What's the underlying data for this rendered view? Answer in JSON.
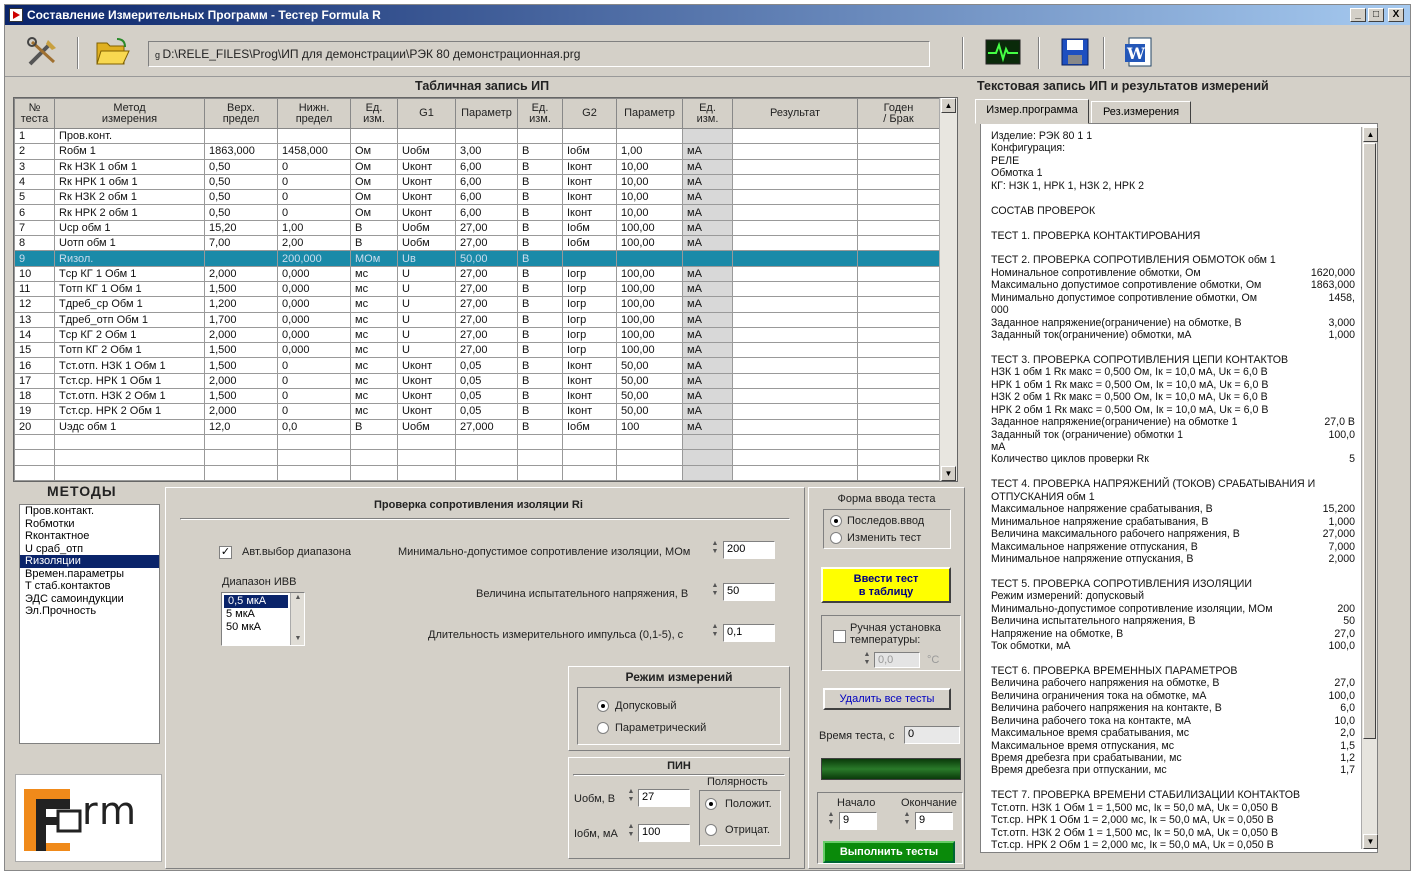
{
  "window": {
    "title": "Составление Измерительных Программ - Тестер Formula R",
    "controls": [
      "_",
      "□",
      "X"
    ]
  },
  "toolbar": {
    "path": "D:\\RELE_FILES\\Prog\\ИП для демонстрации\\РЭК 80 демонстрационная.prg",
    "icons": [
      "tools-icon",
      "folder-open-icon",
      "signal-icon",
      "floppy-save-icon",
      "word-doc-icon"
    ]
  },
  "table_section": {
    "title": "Табличная запись ИП",
    "headers": [
      "№\nтеста",
      "Метод\nизмерения",
      "Верх.\nпредел",
      "Нижн.\nпредел",
      "Ед.\nизм.",
      "G1",
      "Параметр",
      "Ед.\nизм.",
      "G2",
      "Параметр",
      "Ед.\nизм.",
      "Результат",
      "Годен\n/ Брак"
    ],
    "rows": [
      [
        "1",
        "Пров.конт.",
        "",
        "",
        "",
        "",
        "",
        "",
        "",
        "",
        "",
        "",
        ""
      ],
      [
        "2",
        "Rобм 1",
        "1863,000",
        "1458,000",
        "Ом",
        "Uобм",
        "3,00",
        "В",
        "Iобм",
        "1,00",
        "мА",
        "",
        ""
      ],
      [
        "3",
        "Rк НЗК 1 обм 1",
        "0,50",
        "0",
        "Ом",
        "Uконт",
        "6,00",
        "В",
        "Iконт",
        "10,00",
        "мА",
        "",
        ""
      ],
      [
        "4",
        "Rк НРК 1 обм 1",
        "0,50",
        "0",
        "Ом",
        "Uконт",
        "6,00",
        "В",
        "Iконт",
        "10,00",
        "мА",
        "",
        ""
      ],
      [
        "5",
        "Rк НЗК 2 обм 1",
        "0,50",
        "0",
        "Ом",
        "Uконт",
        "6,00",
        "В",
        "Iконт",
        "10,00",
        "мА",
        "",
        ""
      ],
      [
        "6",
        "Rк НРК 2 обм 1",
        "0,50",
        "0",
        "Ом",
        "Uконт",
        "6,00",
        "В",
        "Iконт",
        "10,00",
        "мА",
        "",
        ""
      ],
      [
        "7",
        "Uср обм 1",
        "15,20",
        "1,00",
        "В",
        "Uобм",
        "27,00",
        "В",
        "Iобм",
        "100,00",
        "мА",
        "",
        ""
      ],
      [
        "8",
        "Uотп обм 1",
        "7,00",
        "2,00",
        "В",
        "Uобм",
        "27,00",
        "В",
        "Iобм",
        "100,00",
        "мА",
        "",
        ""
      ],
      [
        "9",
        "Rизол.",
        "",
        "200,000",
        "МОм",
        "Uв",
        "50,00",
        "В",
        "",
        "",
        "",
        "",
        ""
      ],
      [
        "10",
        "Tср КГ 1 Обм 1",
        "2,000",
        "0,000",
        "мс",
        "U",
        "27,00",
        "В",
        "Iогр",
        "100,00",
        "мА",
        "",
        ""
      ],
      [
        "11",
        "Tотп КГ 1 Обм 1",
        "1,500",
        "0,000",
        "мс",
        "U",
        "27,00",
        "В",
        "Iогр",
        "100,00",
        "мА",
        "",
        ""
      ],
      [
        "12",
        "Tдреб_ср Обм 1",
        "1,200",
        "0,000",
        "мс",
        "U",
        "27,00",
        "В",
        "Iогр",
        "100,00",
        "мА",
        "",
        ""
      ],
      [
        "13",
        "Tдреб_отп Обм 1",
        "1,700",
        "0,000",
        "мс",
        "U",
        "27,00",
        "В",
        "Iогр",
        "100,00",
        "мА",
        "",
        ""
      ],
      [
        "14",
        "Tср КГ 2 Обм 1",
        "2,000",
        "0,000",
        "мс",
        "U",
        "27,00",
        "В",
        "Iогр",
        "100,00",
        "мА",
        "",
        ""
      ],
      [
        "15",
        "Tотп КГ 2 Обм 1",
        "1,500",
        "0,000",
        "мс",
        "U",
        "27,00",
        "В",
        "Iогр",
        "100,00",
        "мА",
        "",
        ""
      ],
      [
        "16",
        "Tст.отп. НЗК 1 Обм 1",
        "1,500",
        "0",
        "мс",
        "Uконт",
        "0,05",
        "В",
        "Iконт",
        "50,00",
        "мА",
        "",
        ""
      ],
      [
        "17",
        "Tст.ср. НРК 1 Обм 1",
        "2,000",
        "0",
        "мс",
        "Uконт",
        "0,05",
        "В",
        "Iконт",
        "50,00",
        "мА",
        "",
        ""
      ],
      [
        "18",
        "Tст.отп. НЗК 2 Обм 1",
        "1,500",
        "0",
        "мс",
        "Uконт",
        "0,05",
        "В",
        "Iконт",
        "50,00",
        "мА",
        "",
        ""
      ],
      [
        "19",
        "Tст.ср. НРК 2 Обм 1",
        "2,000",
        "0",
        "мс",
        "Uконт",
        "0,05",
        "В",
        "Iконт",
        "50,00",
        "мА",
        "",
        ""
      ],
      [
        "20",
        "Uэдс обм 1",
        "12,0",
        "0,0",
        "В",
        "Uобм",
        "27,000",
        "В",
        "Iобм",
        "100",
        "мА",
        "",
        ""
      ],
      [
        "",
        "",
        "",
        "",
        "",
        "",
        "",
        "",
        "",
        "",
        "",
        "",
        ""
      ],
      [
        "",
        "",
        "",
        "",
        "",
        "",
        "",
        "",
        "",
        "",
        "",
        "",
        ""
      ],
      [
        "",
        "",
        "",
        "",
        "",
        "",
        "",
        "",
        "",
        "",
        "",
        "",
        ""
      ]
    ],
    "selected_row": 8
  },
  "methods": {
    "title": "МЕТОДЫ",
    "items": [
      "Пров.контакт.",
      "Rобмотки",
      "Rконтактное",
      "U сраб_отп",
      "Rизоляции",
      "Времен.параметры",
      "T стаб.контактов",
      "ЭДС самоиндукции",
      "Эл.Прочность"
    ],
    "selected": 4
  },
  "logo": {
    "text": "rm"
  },
  "settings": {
    "title": "Проверка сопротивления изоляции  Ri",
    "auto_range_label": "Авт.выбор диапазона",
    "auto_range_checked": true,
    "range_label": "Диапазон ИВВ",
    "range_options": [
      "0,5 мкА",
      "5 мкА",
      "50 мкА"
    ],
    "range_selected": 0,
    "min_res_label": "Минимально-допустимое сопротивление изоляции, МОм",
    "min_res_value": "200",
    "test_voltage_label": "Величина испытательного напряжения, В",
    "test_voltage_value": "50",
    "pulse_label": "Длительность измерительного импульса (0,1-5), с",
    "pulse_value": "0,1"
  },
  "mode": {
    "title": "Режим измерений",
    "options": [
      "Допусковый",
      "Параметрический"
    ],
    "selected": 0
  },
  "pin": {
    "title": "ПИН",
    "u_label": "Uобм, В",
    "u_value": "27",
    "i_label": "Iобм, мА",
    "i_value": "100",
    "polarity_label": "Полярность",
    "polarity_options": [
      "Положит.",
      "Отрицат."
    ],
    "polarity_selected": 0
  },
  "input_form": {
    "title": "Форма ввода теста",
    "options": [
      "Последов.ввод",
      "Изменить тест"
    ],
    "selected": 0,
    "enter_button": "Ввести тест\nв таблицу",
    "manual_temp_label": "Ручная установка\nтемпературы:",
    "manual_temp_checked": false,
    "temp_value": "0,0",
    "temp_unit": "°С",
    "delete_all_button": "Удалить все тесты",
    "test_time_label": "Время теста, с",
    "test_time_value": "0",
    "start_label": "Начало",
    "start_value": "9",
    "end_label": "Окончание",
    "end_value": "9",
    "run_button": "Выполнить тесты"
  },
  "text_section": {
    "title": "Текстовая запись ИП и результатов измерений",
    "tabs": [
      "Измер.программа",
      "Рез.измерения"
    ],
    "active_tab": 0,
    "lines": [
      [
        "Изделие: РЭК 80      1       1",
        ""
      ],
      [
        "Конфигурация:",
        ""
      ],
      [
        "РЕЛЕ",
        ""
      ],
      [
        "Обмотка 1",
        ""
      ],
      [
        "КГ: НЗК 1, НРК 1, НЗК 2, НРК 2",
        ""
      ],
      [
        "",
        ""
      ],
      [
        "СОСТАВ ПРОВЕРОК",
        ""
      ],
      [
        "",
        ""
      ],
      [
        "ТЕСТ 1. ПРОВЕРКА КОНТАКТИРОВАНИЯ",
        ""
      ],
      [
        "",
        ""
      ],
      [
        "ТЕСТ 2. ПРОВЕРКА СОПРОТИВЛЕНИЯ ОБМОТОК  обм 1",
        ""
      ],
      [
        "Номинальное сопротивление обмотки, Ом",
        "1620,000"
      ],
      [
        "Максимально допустимое сопротивление обмотки, Ом",
        "1863,000"
      ],
      [
        "Минимально допустимое сопротивление обмотки, Ом",
        "1458,"
      ],
      [
        "000",
        ""
      ],
      [
        "Заданное напряжение(ограничение) на обмотке, В",
        "3,000"
      ],
      [
        "Заданный ток(ограничение) обмотки, мА",
        "1,000"
      ],
      [
        "",
        ""
      ],
      [
        "ТЕСТ 3. ПРОВЕРКА СОПРОТИВЛЕНИЯ ЦЕПИ КОНТАКТОВ",
        ""
      ],
      [
        "НЗК 1 обм 1    Rк макс = 0,500 Ом,   Iк = 10,0 мА,   Uк = 6,0 В",
        ""
      ],
      [
        "НРК 1 обм 1    Rк макс = 0,500 Ом,   Iк = 10,0 мА,   Uк = 6,0 В",
        ""
      ],
      [
        "НЗК 2 обм 1    Rк макс = 0,500 Ом,   Iк = 10,0 мА,   Uк = 6,0 В",
        ""
      ],
      [
        "НРК 2 обм 1    Rк макс = 0,500 Ом,   Iк = 10,0 мА,   Uк = 6,0 В",
        ""
      ],
      [
        "Заданное напряжение(ограничение) на обмотке 1",
        "27,0 В"
      ],
      [
        "Заданный ток (ограничение) обмотки 1",
        "100,0"
      ],
      [
        "мА",
        ""
      ],
      [
        "Количество циклов проверки Rк",
        "5"
      ],
      [
        "",
        ""
      ],
      [
        "ТЕСТ 4. ПРОВЕРКА НАПРЯЖЕНИЙ (ТОКОВ) СРАБАТЫВАНИЯ И",
        ""
      ],
      [
        "ОТПУСКАНИЯ  обм 1",
        ""
      ],
      [
        "Максимальное напряжение срабатывания, В",
        "15,200"
      ],
      [
        "Минимальное напряжение срабатывания, В",
        "1,000"
      ],
      [
        "Величина максимального рабочего напряжения, В",
        "27,000"
      ],
      [
        "Максимальное напряжение отпускания, В",
        "7,000"
      ],
      [
        "Минимальное напряжение отпускания, В",
        "2,000"
      ],
      [
        "",
        ""
      ],
      [
        "ТЕСТ 5. ПРОВЕРКА СОПРОТИВЛЕНИЯ ИЗОЛЯЦИИ",
        ""
      ],
      [
        "Режим измерений: допусковый",
        ""
      ],
      [
        "Минимально-допустимое сопротивление изоляции, МОм",
        "200"
      ],
      [
        "Величина испытательного напряжения, В",
        "50"
      ],
      [
        "Напряжение на обмотке, В",
        "27,0"
      ],
      [
        "Ток обмотки, мА",
        "100,0"
      ],
      [
        "",
        ""
      ],
      [
        "ТЕСТ 6. ПРОВЕРКА ВРЕМЕННЫХ ПАРАМЕТРОВ",
        ""
      ],
      [
        "Величина рабочего напряжения на обмотке, В",
        "27,0"
      ],
      [
        "Величина ограничения тока на обмотке, мА",
        "100,0"
      ],
      [
        "Величина рабочего напряжения на контакте, В",
        "6,0"
      ],
      [
        "Величина рабочего тока на контакте, мА",
        "10,0"
      ],
      [
        "Максимальное время срабатывания, мс",
        "2,0"
      ],
      [
        "Максимальное время отпускания, мс",
        "1,5"
      ],
      [
        "Время дребезга при срабатывании, мс",
        "1,2"
      ],
      [
        "Время дребезга при отпускании, мс",
        "1,7"
      ],
      [
        "",
        ""
      ],
      [
        "ТЕСТ 7. ПРОВЕРКА ВРЕМЕНИ СТАБИЛИЗАЦИИ КОНТАКТОВ",
        ""
      ],
      [
        "Tст.отп. НЗК 1 Обм 1  = 1,500 мс,   Iк = 50,0 мА,   Uк = 0,050 В",
        ""
      ],
      [
        "Tст.ср. НРК 1 Обм 1   = 2,000 мс,   Iк = 50,0 мА,   Uк = 0,050 В",
        ""
      ],
      [
        "Tст.отп. НЗК 2 Обм 1  = 1,500 мс,   Iк = 50,0 мА,   Uк = 0,050 В",
        ""
      ],
      [
        "Tст.ср. НРК 2 Обм 1   = 2,000 мс,   Iк = 50,0 мА,   Uк = 0,050 В",
        ""
      ]
    ]
  },
  "colors": {
    "title_bar": "#0a246a",
    "selected_row": "#1a8aa8",
    "enter_button": "#ffff00",
    "run_button": "#008000",
    "led_bar": "#0f5a0f"
  }
}
